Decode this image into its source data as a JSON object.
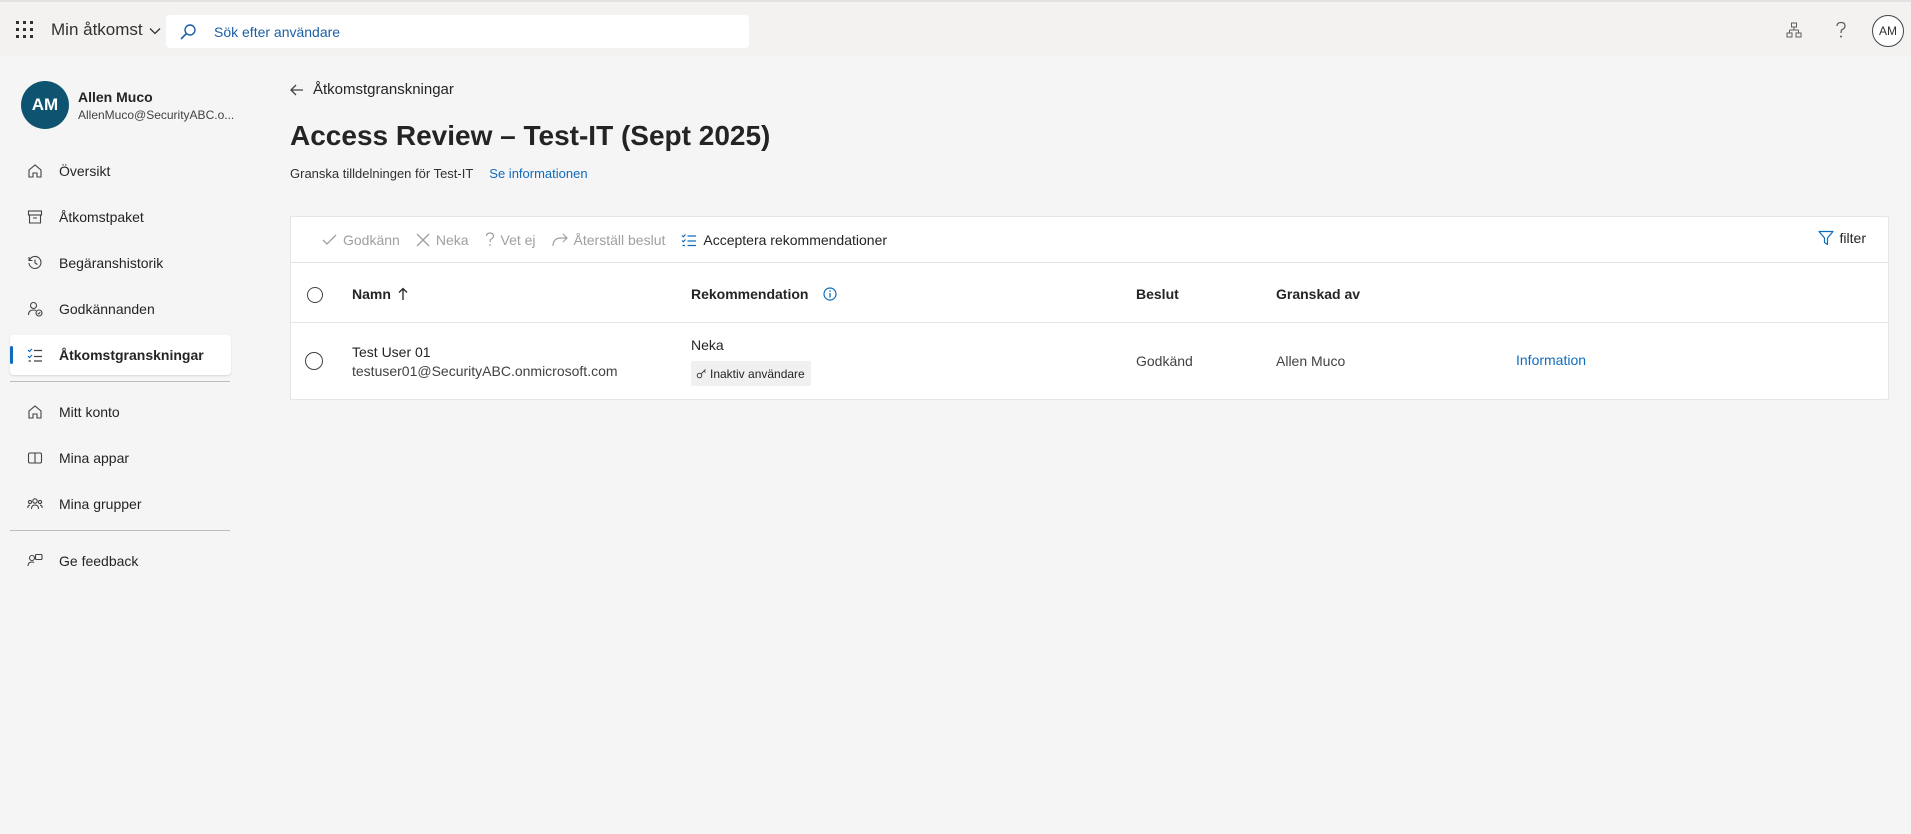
{
  "topbar": {
    "app_title": "Min åtkomst",
    "search_placeholder": "Sök efter användare",
    "avatar_initials": "AM"
  },
  "user": {
    "initials": "AM",
    "name": "Allen Muco",
    "email": "AllenMuco@SecurityABC.o..."
  },
  "nav": {
    "items": [
      {
        "label": "Översikt",
        "icon": "home-icon"
      },
      {
        "label": "Åtkomstpaket",
        "icon": "archive-icon"
      },
      {
        "label": "Begäranshistorik",
        "icon": "history-icon"
      },
      {
        "label": "Godkännanden",
        "icon": "person-approve-icon"
      },
      {
        "label": "Åtkomstgranskningar",
        "icon": "checklist-icon",
        "active": true
      }
    ],
    "items2": [
      {
        "label": "Mitt konto",
        "icon": "home-icon"
      },
      {
        "label": "Mina appar",
        "icon": "apps-icon"
      },
      {
        "label": "Mina grupper",
        "icon": "people-icon"
      }
    ],
    "items3": [
      {
        "label": "Ge feedback",
        "icon": "feedback-icon"
      }
    ]
  },
  "main": {
    "breadcrumb": "Åtkomstgranskningar",
    "title": "Access Review – Test-IT (Sept 2025)",
    "subtitle": "Granska tilldelningen för Test-IT",
    "details_link": "Se informationen"
  },
  "toolbar": {
    "approve": "Godkänn",
    "deny": "Neka",
    "dont_know": "Vet ej",
    "reset": "Återställ beslut",
    "accept_recommendations": "Acceptera rekommendationer",
    "filter": "filter"
  },
  "table": {
    "headers": {
      "name": "Namn",
      "recommendation": "Rekommendation",
      "decision": "Beslut",
      "reviewed_by": "Granskad av"
    },
    "rows": [
      {
        "name": "Test User 01",
        "email": "testuser01@SecurityABC.onmicrosoft.com",
        "recommendation": "Neka",
        "recommendation_reason": "Inaktiv användare",
        "decision": "Godkänd",
        "reviewed_by": "Allen Muco",
        "details": "Information"
      }
    ]
  },
  "colors": {
    "accent": "#0f6cbd",
    "avatar_bg": "#0e5470"
  }
}
